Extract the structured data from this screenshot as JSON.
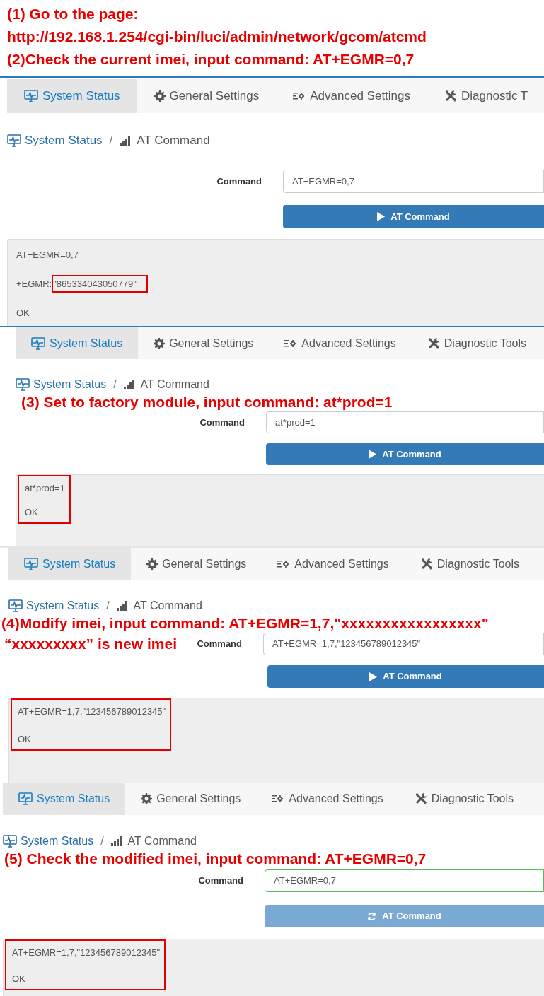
{
  "instructions": [
    "(1) Go to the page:",
    "http://192.168.1.254/cgi-bin/luci/admin/network/gcom/atcmd",
    "(2)Check the current imei, input command: AT+EGMR=0,7"
  ],
  "panels": [
    {
      "tabs": [
        {
          "label": "System Status",
          "selected": true
        },
        {
          "label": "General Settings",
          "selected": false
        },
        {
          "label": "Advanced Settings",
          "selected": false
        },
        {
          "label": "Diagnostic T",
          "selected": false
        }
      ],
      "breadcrumb": {
        "link": "System Status",
        "separator": "/",
        "current": "AT Command"
      },
      "command_label": "Command",
      "command": {
        "value": "AT+EGMR=0,7",
        "focused": false
      },
      "button": {
        "label": "AT Command",
        "busy": false
      },
      "output": {
        "highlighted": false,
        "lines": [
          [
            {
              "text": "AT+EGMR=0,7",
              "highlighted": false
            }
          ],
          [
            {
              "text": "+EGMR:",
              "highlighted": false
            },
            {
              "text": "\"865334043050779\"",
              "highlighted": true
            }
          ],
          [
            {
              "text": "OK",
              "highlighted": false
            }
          ]
        ]
      }
    },
    {
      "tabs": [
        {
          "label": "System Status",
          "selected": true
        },
        {
          "label": "General Settings",
          "selected": false
        },
        {
          "label": "Advanced Settings",
          "selected": false
        },
        {
          "label": "Diagnostic Tools",
          "selected": false
        }
      ],
      "breadcrumb": {
        "link": "System Status",
        "separator": "/",
        "current": "AT Command"
      },
      "annotation": "(3) Set to factory module, input command: at*prod=1",
      "command_label": "Command",
      "command": {
        "value": "at*prod=1",
        "focused": false
      },
      "button": {
        "label": "AT Command",
        "busy": false
      },
      "output": {
        "highlighted": true,
        "lines": [
          [
            {
              "text": "at*prod=1",
              "highlighted": false
            }
          ],
          [
            {
              "text": "OK",
              "highlighted": false
            }
          ]
        ]
      }
    },
    {
      "tabs": [
        {
          "label": "System Status",
          "selected": true
        },
        {
          "label": "General Settings",
          "selected": false
        },
        {
          "label": "Advanced Settings",
          "selected": false
        },
        {
          "label": "Diagnostic Tools",
          "selected": false
        }
      ],
      "breadcrumb": {
        "link": "System Status",
        "separator": "/",
        "current": "AT Command"
      },
      "annotation": "(4)Modify imei, input command: AT+EGMR=1,7,\"xxxxxxxxxxxxxxxxx\"",
      "side_note": "“xxxxxxxxx” is new imei",
      "command_label": "Command",
      "command": {
        "value": "AT+EGMR=1,7,\"123456789012345\"",
        "focused": false
      },
      "button": {
        "label": "AT Command",
        "busy": false
      },
      "output": {
        "highlighted": true,
        "lines": [
          [
            {
              "text": "AT+EGMR=1,7,\"123456789012345\"",
              "highlighted": false
            }
          ],
          [
            {
              "text": "OK",
              "highlighted": false
            }
          ]
        ]
      }
    },
    {
      "tabs": [
        {
          "label": "System Status",
          "selected": true
        },
        {
          "label": "General Settings",
          "selected": false
        },
        {
          "label": "Advanced Settings",
          "selected": false
        },
        {
          "label": "Diagnostic Tools",
          "selected": false
        }
      ],
      "breadcrumb": {
        "link": "System Status",
        "separator": "/",
        "current": "AT Command"
      },
      "annotation": "(5) Check the modified imei, input command: AT+EGMR=0,7",
      "command_label": "Command",
      "command": {
        "value": "AT+EGMR=0,7",
        "focused": true
      },
      "button": {
        "label": "AT Command",
        "busy": true
      },
      "output": {
        "highlighted": true,
        "lines": [
          [
            {
              "text": "AT+EGMR=1,7,\"123456789012345\"",
              "highlighted": false
            }
          ],
          [
            {
              "text": "OK",
              "highlighted": false
            }
          ]
        ]
      }
    }
  ]
}
